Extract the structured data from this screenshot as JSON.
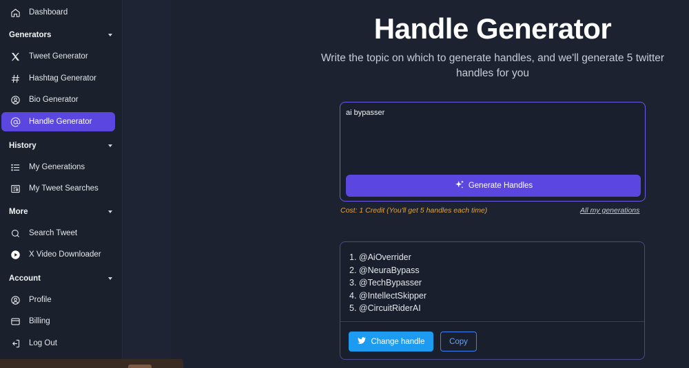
{
  "sidebar": {
    "dashboard": "Dashboard",
    "sections": {
      "generators": "Generators",
      "history": "History",
      "more": "More",
      "account": "Account"
    },
    "items": {
      "tweet_generator": "Tweet Generator",
      "hashtag_generator": "Hashtag Generator",
      "bio_generator": "Bio Generator",
      "handle_generator": "Handle Generator",
      "my_generations": "My Generations",
      "my_tweet_searches": "My Tweet Searches",
      "search_tweet": "Search Tweet",
      "x_video_downloader": "X Video Downloader",
      "profile": "Profile",
      "billing": "Billing",
      "log_out": "Log Out"
    }
  },
  "main": {
    "title": "Handle Generator",
    "subtitle_line1": "Write the topic on which to generate handles, and we'll generate 5 twitter",
    "subtitle_line2": "handles for you",
    "input_value": "ai bypasser",
    "generate_button": "Generate Handles",
    "cost_note": "Cost: 1 Credit (You'll get 5 handles each time)",
    "all_generations_link": "All my generations",
    "results": [
      "1. @AiOverrider",
      "2. @NeuraBypass",
      "3. @TechBypasser",
      "4. @IntellectSkipper",
      "5. @CircuitRiderAI"
    ],
    "change_handle_button": "Change handle",
    "copy_button": "Copy"
  },
  "colors": {
    "accent": "#5b47e0",
    "twitter_blue": "#1d9bf0",
    "cost_text": "#e5a43a",
    "background": "#1c2230"
  }
}
